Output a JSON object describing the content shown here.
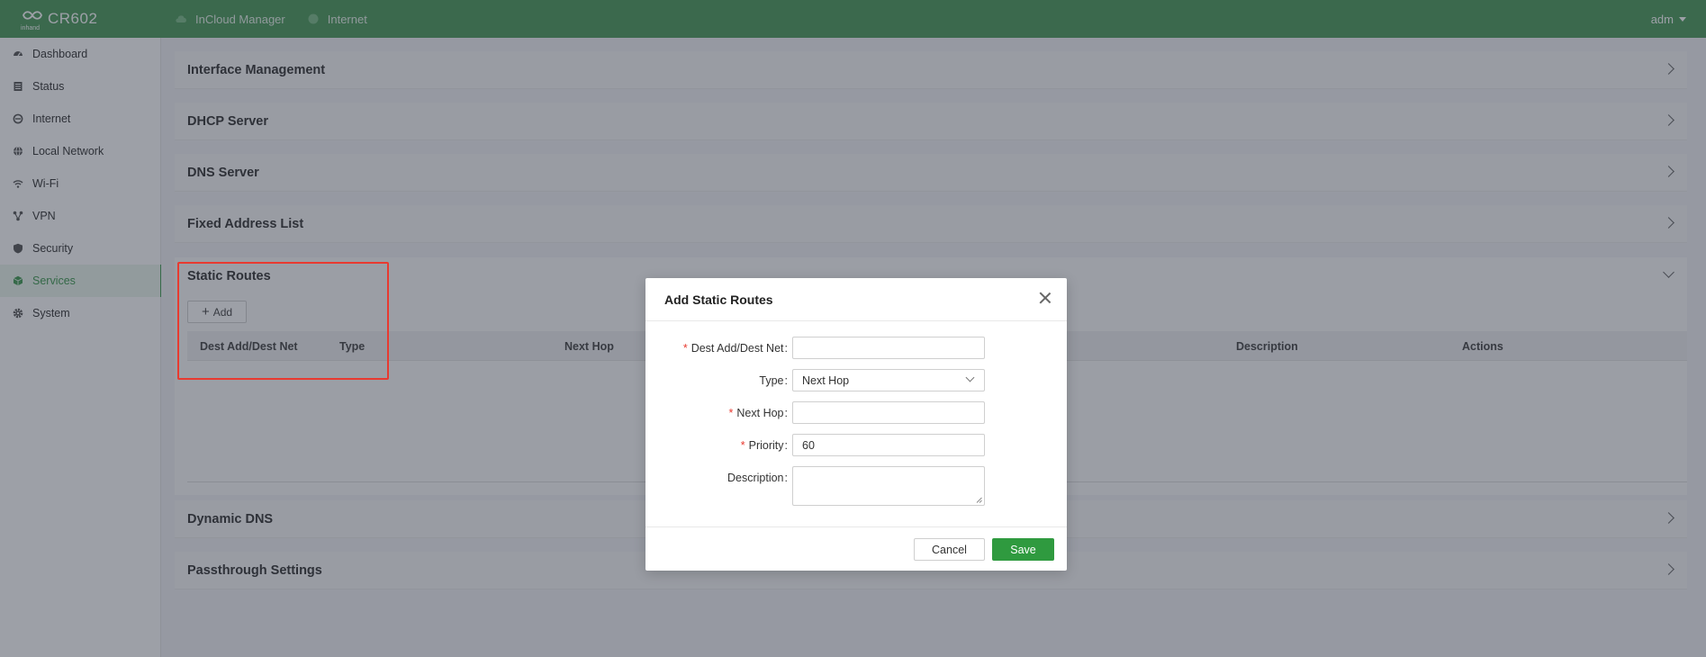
{
  "header": {
    "brand": "CR602",
    "brand_sub": "inhand",
    "nav": [
      {
        "label": "InCloud Manager",
        "icon": "cloud-icon"
      },
      {
        "label": "Internet",
        "icon": "globe-status-icon"
      }
    ],
    "user": "adm"
  },
  "sidebar": {
    "items": [
      {
        "label": "Dashboard",
        "icon": "dashboard-icon"
      },
      {
        "label": "Status",
        "icon": "status-icon"
      },
      {
        "label": "Internet",
        "icon": "internet-icon"
      },
      {
        "label": "Local Network",
        "icon": "globe-icon"
      },
      {
        "label": "Wi-Fi",
        "icon": "wifi-icon"
      },
      {
        "label": "VPN",
        "icon": "vpn-icon"
      },
      {
        "label": "Security",
        "icon": "shield-icon"
      },
      {
        "label": "Services",
        "icon": "cube-icon"
      },
      {
        "label": "System",
        "icon": "gear-icon"
      }
    ],
    "active": "Services"
  },
  "panels": {
    "interface_management": "Interface Management",
    "dhcp_server": "DHCP Server",
    "dns_server": "DNS Server",
    "fixed_address_list": "Fixed Address List",
    "static_routes": "Static Routes",
    "dynamic_dns": "Dynamic DNS",
    "passthrough_settings": "Passthrough Settings"
  },
  "static_routes": {
    "add_label": "Add",
    "columns": [
      "Dest Add/Dest Net",
      "Type",
      "Next Hop",
      "Description",
      "Actions"
    ]
  },
  "modal": {
    "title": "Add Static Routes",
    "fields": {
      "dest": {
        "label": "Dest Add/Dest Net",
        "required": "*",
        "value": ""
      },
      "type": {
        "label": "Type",
        "value": "Next Hop"
      },
      "next_hop": {
        "label": "Next Hop",
        "required": "*",
        "value": ""
      },
      "priority": {
        "label": "Priority",
        "required": "*",
        "value": "60"
      },
      "description": {
        "label": "Description",
        "value": ""
      }
    },
    "colon": ":",
    "cancel_label": "Cancel",
    "save_label": "Save"
  },
  "colors": {
    "brand_green": "#4a9a59",
    "save_green": "#2f9a3f",
    "highlight_red": "#e83a30"
  }
}
